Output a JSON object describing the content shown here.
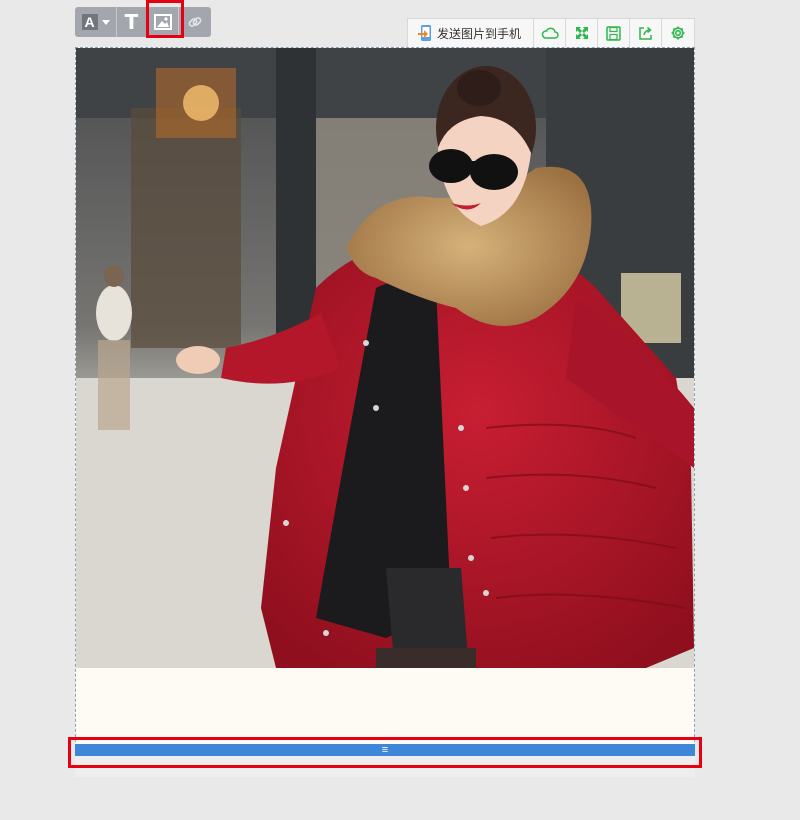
{
  "toolbar": {
    "font_letter": "A",
    "text_glyph": "T",
    "items": [
      "font-icon",
      "text-icon",
      "image-icon",
      "link-icon"
    ]
  },
  "right_toolbar": {
    "send_label": "发送图片到手机",
    "icons": [
      "phone-send-icon",
      "cloud-icon",
      "fullscreen-icon",
      "save-icon",
      "share-icon",
      "gear-icon"
    ],
    "accent": "#2db84d"
  },
  "highlight_color": "#e60012",
  "bottom_bar": {
    "grip": "≡",
    "color": "#3d86d8"
  }
}
